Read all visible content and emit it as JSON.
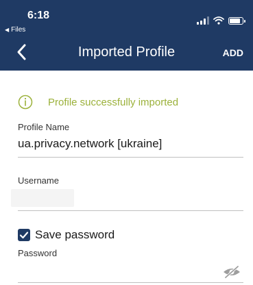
{
  "status_bar": {
    "time": "6:18",
    "back_app": "Files"
  },
  "nav": {
    "title": "Imported Profile",
    "action": "ADD"
  },
  "notice": {
    "text": "Profile successfully imported",
    "color": "#9bb13a"
  },
  "fields": {
    "profile_name": {
      "label": "Profile Name",
      "value": "ua.privacy.network [ukraine]"
    },
    "username": {
      "label": "Username",
      "value": ""
    },
    "save_password": {
      "label": "Save password",
      "checked": true
    },
    "password": {
      "label": "Password",
      "value": ""
    }
  },
  "colors": {
    "header": "#1f3a64",
    "accent": "#9bb13a"
  }
}
